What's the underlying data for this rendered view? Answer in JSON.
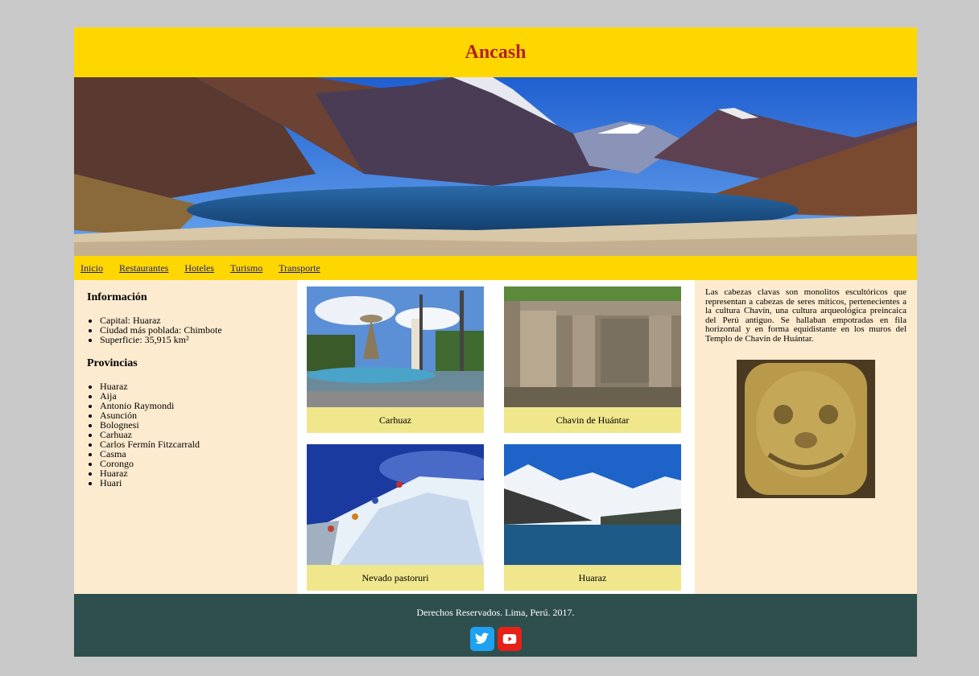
{
  "header": {
    "title": "Ancash"
  },
  "nav": {
    "items": [
      "Inicio",
      "Restaurantes",
      "Hoteles",
      "Turismo",
      "Transporte"
    ]
  },
  "info": {
    "heading": "Información",
    "items": [
      "Capital: Huaraz",
      "Ciudad más poblada: Chimbote",
      "Superficie: 35,915 km²"
    ]
  },
  "provincias": {
    "heading": "Provincias",
    "items": [
      "Huaraz",
      "Aija",
      "Antonio Raymondi",
      "Asunción",
      "Bolognesi",
      "Carhuaz",
      "Carlos Fermín Fitzcarrald",
      "Casma",
      "Corongo",
      "Huaraz",
      "Huari"
    ]
  },
  "gallery": {
    "items": [
      {
        "caption": "Carhuaz",
        "icon": "fountain-photo"
      },
      {
        "caption": "Chavin de Huántar",
        "icon": "ruins-photo"
      },
      {
        "caption": "Nevado pastoruri",
        "icon": "glacier-photo"
      },
      {
        "caption": "Huaraz",
        "icon": "mountain-lake-photo"
      }
    ]
  },
  "description": "Las cabezas clavas son monolitos escultóricos que representan a cabezas de seres míticos, pertenecientes a la cultura Chavín, una cultura arqueológica preincaica del Perú antiguo. Se hallaban empotradas en fila horizontal y en forma equidistante en los muros del Templo de Chavín de Huántar.",
  "footer": {
    "copyright": "Derechos Reservados. Lima, Perú. 2017.",
    "social": [
      "twitter-icon",
      "youtube-icon"
    ]
  },
  "colors": {
    "header_bg": "#ffd700",
    "title": "#b22222",
    "content_bg": "#fdebd0",
    "caption_bg": "#f0e68c",
    "footer_bg": "#2f4f4f",
    "twitter": "#1da1f2",
    "youtube": "#e62117"
  }
}
